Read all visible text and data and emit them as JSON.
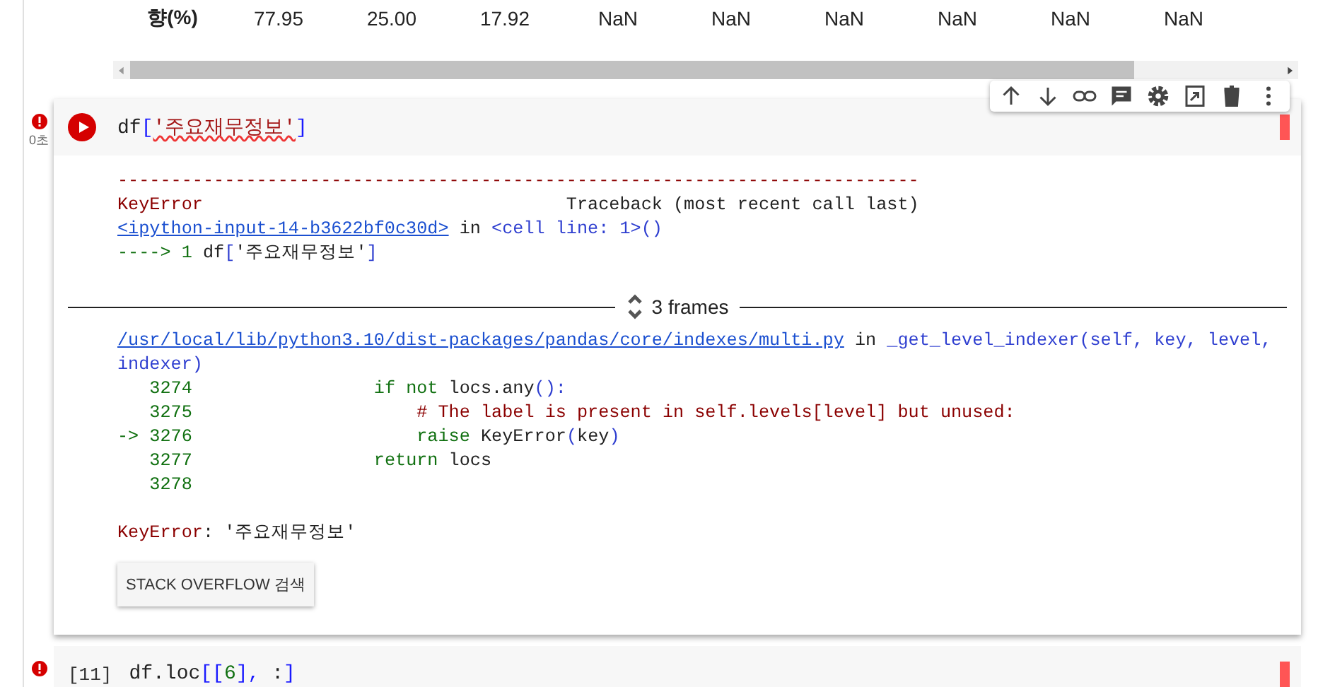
{
  "table_row": {
    "header": "향(%)",
    "values": [
      "77.95",
      "25.00",
      "17.92",
      "NaN",
      "NaN",
      "NaN",
      "NaN",
      "NaN",
      "NaN"
    ]
  },
  "cells": [
    {
      "error": true,
      "selected": true,
      "exec_time": "0초",
      "code": [
        {
          "kind": "name",
          "text": "df"
        },
        {
          "kind": "bracket",
          "text": "["
        },
        {
          "kind": "string",
          "text": "'주요재무정보'"
        },
        {
          "kind": "bracket",
          "text": "]"
        }
      ],
      "output": {
        "lines": [
          [
            {
              "kind": "err",
              "text": "---------------------------------------------------------------------------"
            }
          ],
          [
            {
              "kind": "err",
              "text": "KeyError"
            },
            {
              "kind": "plain",
              "text": "                                  Traceback (most recent call last)"
            }
          ],
          [
            {
              "kind": "link",
              "text": "<ipython-input-14-b3622bf0c30d>"
            },
            {
              "kind": "plain",
              "text": " in "
            },
            {
              "kind": "func",
              "text": "<cell line: 1>()"
            }
          ],
          [
            {
              "kind": "num",
              "text": "----> 1 "
            },
            {
              "kind": "plain",
              "text": "df"
            },
            {
              "kind": "func",
              "text": "["
            },
            {
              "kind": "plain",
              "text": "'주요재무정보'"
            },
            {
              "kind": "func",
              "text": "]"
            }
          ]
        ],
        "frames": {
          "label": "3 frames",
          "expanded": true
        },
        "frame_lines": [
          [
            {
              "kind": "link",
              "text": "/usr/local/lib/python3.10/dist-packages/pandas/core/indexes/multi.py"
            },
            {
              "kind": "plain",
              "text": " in "
            },
            {
              "kind": "func",
              "text": "_get_level_indexer(self, key, level,"
            }
          ],
          [
            {
              "kind": "func",
              "text": "indexer)"
            }
          ],
          [
            {
              "kind": "num",
              "text": "   3274                 "
            },
            {
              "kind": "kw",
              "text": "if not "
            },
            {
              "kind": "plain",
              "text": "locs.any"
            },
            {
              "kind": "func",
              "text": "():"
            }
          ],
          [
            {
              "kind": "num",
              "text": "   3275                     "
            },
            {
              "kind": "comment",
              "text": "# The label is present in self.levels[level] but unused:"
            }
          ],
          [
            {
              "kind": "num",
              "text": "-> 3276                     "
            },
            {
              "kind": "kw",
              "text": "raise "
            },
            {
              "kind": "plain",
              "text": "KeyError"
            },
            {
              "kind": "func",
              "text": "("
            },
            {
              "kind": "plain",
              "text": "key"
            },
            {
              "kind": "func",
              "text": ")"
            }
          ],
          [
            {
              "kind": "num",
              "text": "   3277                 "
            },
            {
              "kind": "kw",
              "text": "return "
            },
            {
              "kind": "plain",
              "text": "locs"
            }
          ],
          [
            {
              "kind": "num",
              "text": "   3278"
            }
          ]
        ],
        "error_message": [
          {
            "kind": "err",
            "text": "KeyError"
          },
          {
            "kind": "plain",
            "text": ": '주요재무정보'"
          }
        ],
        "search_button": "STACK OVERFLOW 검색"
      }
    },
    {
      "error": true,
      "selected": false,
      "label": "[11]",
      "code": [
        {
          "kind": "name",
          "text": "df.loc"
        },
        {
          "kind": "bracket",
          "text": "[["
        },
        {
          "kind": "num",
          "text": "6"
        },
        {
          "kind": "bracket",
          "text": "],"
        },
        {
          "kind": "name",
          "text": " :"
        },
        {
          "kind": "bracket",
          "text": "]"
        }
      ]
    }
  ]
}
